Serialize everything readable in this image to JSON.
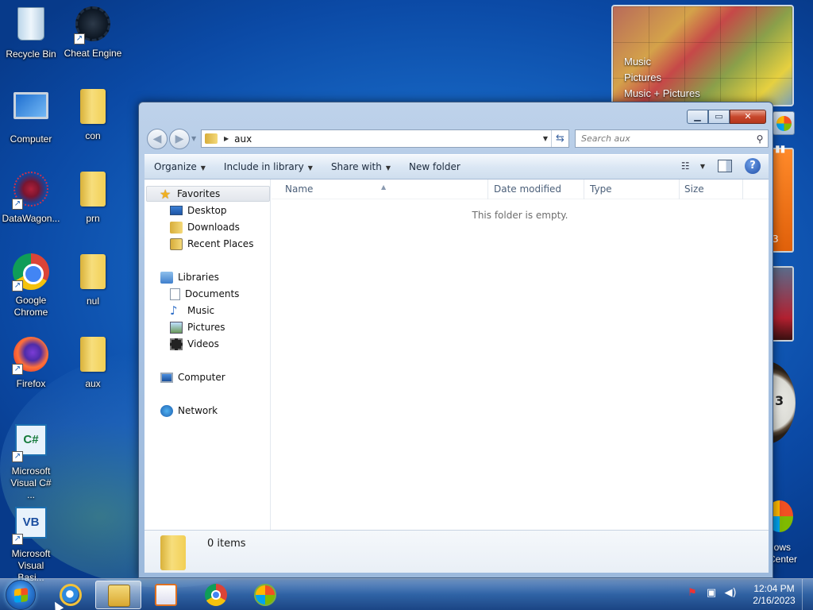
{
  "desktop": {
    "icons": [
      {
        "label": "Recycle Bin"
      },
      {
        "label": "Cheat Engine"
      },
      {
        "label": "Computer"
      },
      {
        "label": "con"
      },
      {
        "label": "DataWagon..."
      },
      {
        "label": "prn"
      },
      {
        "label": "Google Chrome"
      },
      {
        "label": "nul"
      },
      {
        "label": "Firefox"
      },
      {
        "label": "aux"
      },
      {
        "label": "Microsoft Visual C# ..."
      },
      {
        "label": "Microsoft Visual Basi..."
      }
    ]
  },
  "gadgets": {
    "media_center": {
      "items": [
        "Music",
        "Pictures",
        "Music + Pictures"
      ]
    },
    "orange_digit": "3",
    "clock_digit": "3",
    "windows_media_center_label": "dows\nCenter"
  },
  "explorer": {
    "address": {
      "path_segment": "aux"
    },
    "search": {
      "placeholder": "Search aux"
    },
    "toolbar": {
      "organize": "Organize",
      "include_in_library": "Include in library",
      "share_with": "Share with",
      "new_folder": "New folder"
    },
    "nav_pane": {
      "favorites": "Favorites",
      "desktop": "Desktop",
      "downloads": "Downloads",
      "recent_places": "Recent Places",
      "libraries": "Libraries",
      "documents": "Documents",
      "music": "Music",
      "pictures": "Pictures",
      "videos": "Videos",
      "computer": "Computer",
      "network": "Network"
    },
    "columns": {
      "name": "Name",
      "date_modified": "Date modified",
      "type": "Type",
      "size": "Size"
    },
    "empty_message": "This folder is empty.",
    "details": {
      "item_count": "0 items"
    }
  },
  "taskbar": {
    "clock": {
      "time": "12:04 PM",
      "date": "2/16/2023"
    }
  }
}
